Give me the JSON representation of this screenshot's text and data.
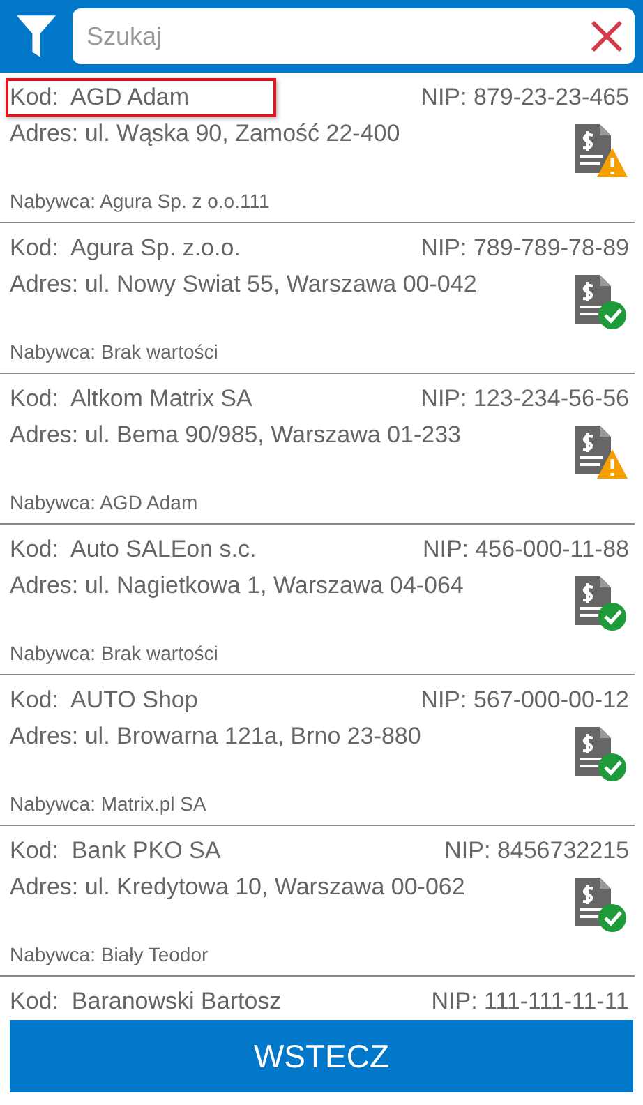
{
  "search": {
    "placeholder": "Szukaj"
  },
  "items": [
    {
      "code_label": "Kod:",
      "code": "AGD Adam",
      "nip": "NIP: 879-23-23-465",
      "address": "Adres: ul. Wąska 90, Zamość 22-400",
      "buyer": "Nabywca: Agura Sp. z o.o.111",
      "warning": true,
      "highlighted": true
    },
    {
      "code_label": "Kod:",
      "code": "Agura Sp. z.o.o.",
      "nip": "NIP: 789-789-78-89",
      "address": "Adres: ul. Nowy Swiat 55, Warszawa 00-042",
      "buyer": "Nabywca: Brak wartości",
      "warning": false,
      "highlighted": false
    },
    {
      "code_label": "Kod:",
      "code": "Altkom Matrix SA",
      "nip": "NIP: 123-234-56-56",
      "address": "Adres: ul. Bema 90/985, Warszawa 01-233",
      "buyer": "Nabywca: AGD Adam",
      "warning": true,
      "highlighted": false
    },
    {
      "code_label": "Kod:",
      "code": "Auto SALEon s.c.",
      "nip": "NIP: 456-000-11-88",
      "address": "Adres: ul. Nagietkowa 1, Warszawa 04-064",
      "buyer": "Nabywca: Brak wartości",
      "warning": false,
      "highlighted": false
    },
    {
      "code_label": "Kod:",
      "code": "AUTO Shop",
      "nip": "NIP: 567-000-00-12",
      "address": "Adres: ul. Browarna 121a, Brno 23-880",
      "buyer": "Nabywca: Matrix.pl SA",
      "warning": false,
      "highlighted": false
    },
    {
      "code_label": "Kod:",
      "code": "Bank PKO SA",
      "nip": "NIP: 8456732215",
      "address": "Adres: ul. Kredytowa 10, Warszawa 00-062",
      "buyer": "Nabywca: Biały Teodor",
      "warning": false,
      "highlighted": false
    },
    {
      "code_label": "Kod:",
      "code": "Baranowski Bartosz",
      "nip": "NIP: 111-111-11-11",
      "highlighted": false
    }
  ],
  "back_button": "WSTECZ"
}
